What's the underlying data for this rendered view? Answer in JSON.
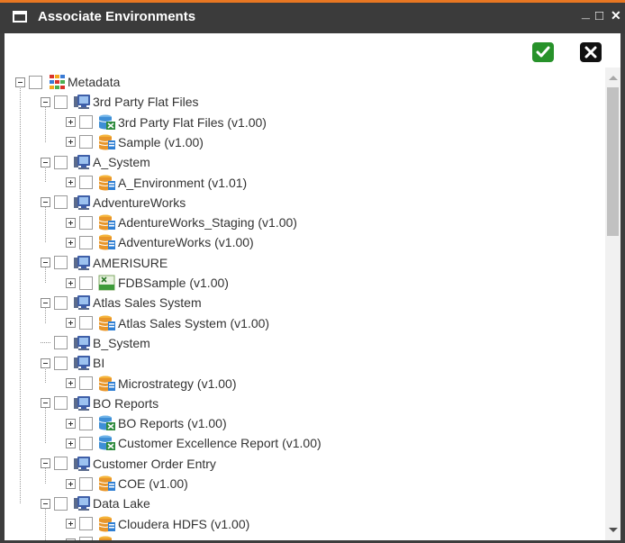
{
  "window": {
    "title": "Associate Environments",
    "controls": {
      "minimize": "_",
      "maximize": "□",
      "close": "✕"
    }
  },
  "toolbar": {
    "ok_icon": "check-icon",
    "cancel_icon": "x-icon",
    "ok_color": "#27922a",
    "cancel_color": "#111111"
  },
  "tree": {
    "root": {
      "label": "Metadata",
      "icon": "grid-icon"
    },
    "systems": [
      {
        "label": "3rd Party Flat Files",
        "envs": [
          {
            "label": "3rd Party Flat Files (v1.00)",
            "icon": "flatfile-db-icon"
          },
          {
            "label": "Sample (v1.00)",
            "icon": "database-icon"
          }
        ]
      },
      {
        "label": "A_System",
        "envs": [
          {
            "label": "A_Environment (v1.01)",
            "icon": "database-icon"
          }
        ]
      },
      {
        "label": "AdventureWorks",
        "envs": [
          {
            "label": "AdentureWorks_Staging (v1.00)",
            "icon": "database-icon"
          },
          {
            "label": "AdventureWorks (v1.00)",
            "icon": "database-icon"
          }
        ]
      },
      {
        "label": "AMERISURE",
        "envs": [
          {
            "label": "FDBSample (v1.00)",
            "icon": "excel-icon"
          }
        ]
      },
      {
        "label": "Atlas Sales System",
        "envs": [
          {
            "label": "Atlas Sales System (v1.00)",
            "icon": "database-icon"
          }
        ]
      },
      {
        "label": "B_System",
        "envs": []
      },
      {
        "label": "BI",
        "envs": [
          {
            "label": "Microstrategy (v1.00)",
            "icon": "database-icon"
          }
        ]
      },
      {
        "label": "BO Reports",
        "envs": [
          {
            "label": "BO Reports (v1.00)",
            "icon": "flatfile-db-icon"
          },
          {
            "label": "Customer Excellence Report (v1.00)",
            "icon": "flatfile-db-icon"
          }
        ]
      },
      {
        "label": "Customer Order Entry",
        "envs": [
          {
            "label": "COE (v1.00)",
            "icon": "database-icon"
          }
        ]
      },
      {
        "label": "Data Lake",
        "envs": [
          {
            "label": "Cloudera HDFS (v1.00)",
            "icon": "database-icon"
          },
          {
            "label": "",
            "icon": "database-icon"
          }
        ]
      }
    ]
  }
}
